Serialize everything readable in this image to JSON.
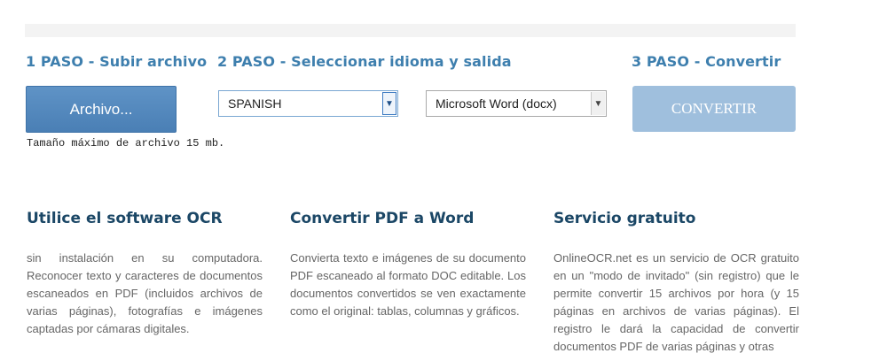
{
  "steps": {
    "step1": "1 PASO - Subir archivo",
    "step2": "2 PASO - Seleccionar idioma y salida",
    "step3": "3 PASO - Convertir"
  },
  "upload": {
    "button_label": "Archivo...",
    "max_size_note": "Tamaño máximo de archivo 15 mb."
  },
  "language_select": {
    "selected": "SPANISH"
  },
  "output_select": {
    "selected": "Microsoft Word (docx)"
  },
  "convert": {
    "button_label": "CONVERTIR"
  },
  "columns": [
    {
      "title": "Utilice el software OCR",
      "text": "sin instalación en su computadora. Reconocer texto y caracteres de documentos escaneados en PDF (incluidos archivos de varias páginas), fotografías e imágenes captadas por cámaras digitales."
    },
    {
      "title": "Convertir PDF a Word",
      "text": "Convierta texto e imágenes de su documento PDF escaneado al formato DOC editable. Los documentos convertidos se ven exactamente como el original: tablas, columnas y gráficos."
    },
    {
      "title": "Servicio gratuito",
      "text": "OnlineOCR.net es un servicio de OCR gratuito en un \"modo de invitado\" (sin registro) que le permite convertir 15 archivos por hora (y 15 páginas en archivos de varias páginas). El registro le dará la capacidad de convertir documentos PDF de varias páginas y otras"
    }
  ],
  "colors": {
    "step_heading": "#3e7fae",
    "file_button": "#4a7fb5",
    "convert_button": "#9fbfdd",
    "column_heading": "#1b4766",
    "body_text": "#666666"
  }
}
